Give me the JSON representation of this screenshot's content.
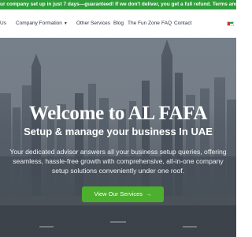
{
  "promo_bar": {
    "text": "our company set up in just 7 days—guaranteed! If we don't deliver, you get a full refund. Terms and conditio"
  },
  "nav": {
    "items": [
      {
        "label": "Us"
      },
      {
        "label": "Company Formation",
        "has_dropdown": true
      },
      {
        "label": "Other Services"
      },
      {
        "label": "Blog"
      },
      {
        "label": "The Fun Zone"
      },
      {
        "label": "FAQ"
      },
      {
        "label": "Contact"
      }
    ],
    "language_flag": "uae-flag-icon"
  },
  "hero": {
    "title": "Welcome to AL FAFA",
    "subtitle": "Setup & manage your business In UAE",
    "description": "Your dedicated advisor answers all your business setup queries, offering seamless, hassle-free growth with comprehensive, all-in-one company setup solutions conveniently under one roof.",
    "cta_label": "View Our Services",
    "cta_icon": "arrow-right-icon"
  },
  "colors": {
    "promo_bg": "#2f9e3a",
    "cta_bg": "#4caf2e",
    "text_dark": "#2b3440"
  }
}
